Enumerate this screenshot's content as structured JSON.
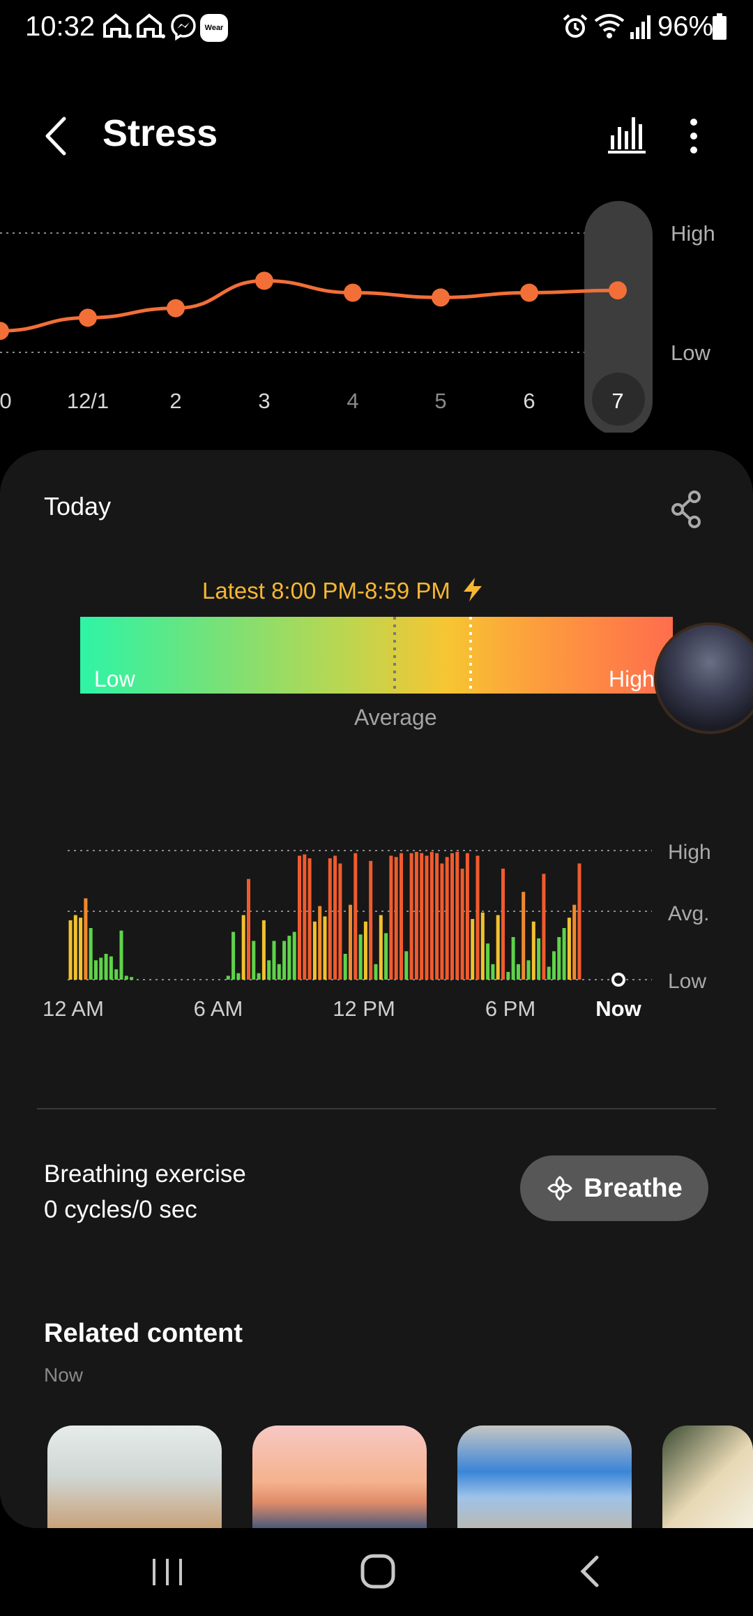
{
  "status_bar": {
    "time": "10:32",
    "battery": "96%",
    "notification_icons": [
      "home-icon",
      "home-icon",
      "messenger-icon",
      "wear-icon"
    ],
    "wear_badge": "Wear",
    "system_icons": [
      "alarm-icon",
      "wifi-icon",
      "signal-icon",
      "battery-icon"
    ]
  },
  "header": {
    "title": "Stress"
  },
  "trend_chart": {
    "y_labels": {
      "high": "High",
      "low": "Low"
    },
    "x_labels": [
      "0",
      "12/1",
      "2",
      "3",
      "4",
      "5",
      "6",
      "7"
    ],
    "selected_label": "7"
  },
  "card": {
    "today_label": "Today",
    "latest_label": "Latest 8:00 PM-8:59 PM",
    "gradient": {
      "low": "Low",
      "high": "High",
      "average": "Average"
    }
  },
  "day_chart": {
    "y_labels": {
      "high": "High",
      "avg": "Avg.",
      "low": "Low"
    },
    "x_labels": [
      "12 AM",
      "6 AM",
      "12 PM",
      "6 PM",
      "Now"
    ]
  },
  "breathing": {
    "title": "Breathing exercise",
    "value": "0 cycles/0 sec",
    "button_label": "Breathe"
  },
  "related": {
    "title": "Related content",
    "subtitle": "Now"
  },
  "colors": {
    "accent_orange": "#f26f38",
    "bar_green": "#5fd34a",
    "bar_yellow": "#f2c12e",
    "bar_red": "#f05b2e",
    "latest_yellow": "#f7b733"
  },
  "chart_data": [
    {
      "type": "line",
      "x": [
        "0",
        "12/1",
        "2",
        "3",
        "4",
        "5",
        "6",
        "7"
      ],
      "series": [
        {
          "values": [
            0.18,
            0.29,
            0.37,
            0.6,
            0.5,
            0.46,
            0.5,
            0.52
          ]
        }
      ],
      "ylim": [
        0,
        1
      ],
      "y_tick_labels": [
        "Low",
        "High"
      ]
    },
    {
      "type": "bar",
      "x_tick_labels": [
        "12 AM",
        "6 AM",
        "12 PM",
        "6 PM",
        "Now"
      ],
      "y_tick_labels": [
        "Low",
        "Avg.",
        "High"
      ],
      "ylim": [
        0,
        1
      ],
      "values": [
        0.46,
        0.5,
        0.48,
        0.63,
        0.4,
        0.15,
        0.17,
        0.2,
        0.18,
        0.08,
        0.38,
        0.03,
        0.02,
        0.0,
        0.0,
        0.0,
        0.0,
        0.0,
        0.0,
        0.0,
        0.0,
        0.0,
        0.0,
        0.0,
        0.0,
        0.0,
        0.0,
        0.0,
        0.0,
        0.0,
        0.0,
        0.03,
        0.37,
        0.05,
        0.5,
        0.78,
        0.3,
        0.05,
        0.46,
        0.15,
        0.3,
        0.12,
        0.3,
        0.34,
        0.37,
        0.96,
        0.97,
        0.94,
        0.45,
        0.57,
        0.49,
        0.94,
        0.96,
        0.9,
        0.2,
        0.58,
        0.98,
        0.35,
        0.45,
        0.92,
        0.12,
        0.5,
        0.36,
        0.96,
        0.95,
        0.98,
        0.22,
        0.98,
        0.99,
        0.98,
        0.96,
        0.99,
        0.98,
        0.9,
        0.95,
        0.98,
        0.99,
        0.86,
        0.98,
        0.47,
        0.96,
        0.52,
        0.28,
        0.12,
        0.5,
        0.86,
        0.06,
        0.33,
        0.12,
        0.68,
        0.15,
        0.45,
        0.32,
        0.82,
        0.1,
        0.22,
        0.33,
        0.4,
        0.48,
        0.58,
        0.9
      ]
    }
  ]
}
